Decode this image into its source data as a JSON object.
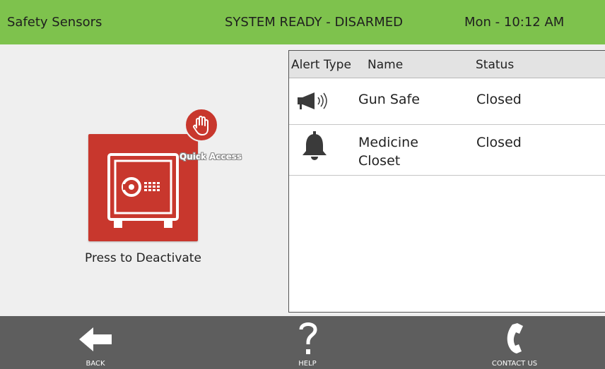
{
  "header": {
    "title": "Safety Sensors",
    "system_status": "SYSTEM READY - DISARMED",
    "datetime": "Mon - 10:12 AM",
    "bar_color": "#7ec24d"
  },
  "safe_panel": {
    "tile_icon": "safe-icon",
    "tile_color": "#c8372d",
    "badge_icon": "hand-stop-icon",
    "badge_label": "Quick Access",
    "action_label": "Press to Deactivate"
  },
  "sensor_table": {
    "columns": [
      "Alert Type",
      "Name",
      "Status"
    ],
    "rows": [
      {
        "alert_icon": "siren-speaker-icon",
        "name": "Gun Safe",
        "status": "Closed"
      },
      {
        "alert_icon": "bell-icon",
        "name": "Medicine Closet",
        "status": "Closed"
      }
    ]
  },
  "bottom_nav": {
    "back": {
      "icon": "arrow-left-icon",
      "label": "BACK"
    },
    "help": {
      "icon": "question-mark-icon",
      "label": "HELP"
    },
    "contact": {
      "icon": "phone-icon",
      "label": "CONTACT US"
    }
  }
}
